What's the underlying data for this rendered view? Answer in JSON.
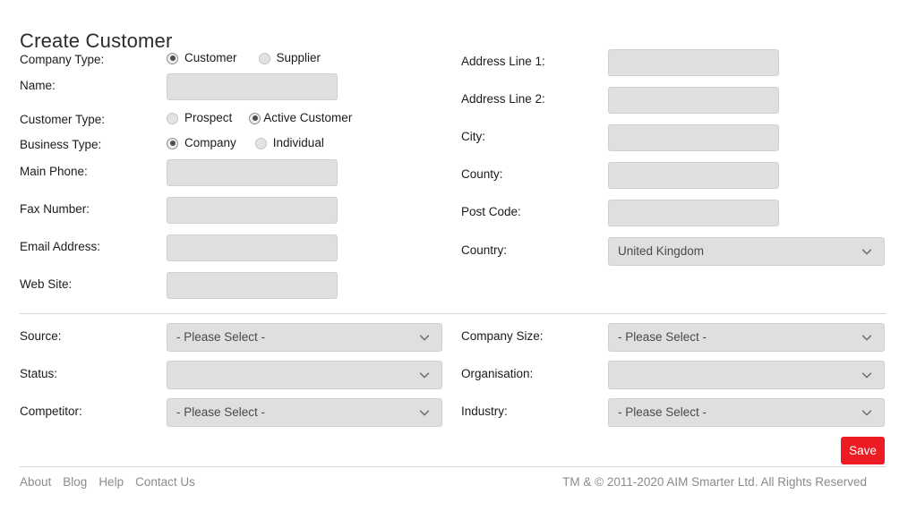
{
  "page": {
    "title": "Create Customer"
  },
  "colors": {
    "accent": "#ed1c24",
    "field_bg": "#dfdfdf",
    "field_border": "#cfcfcf",
    "label_text": "#1b1b1b",
    "footer_text": "#8b8b8b",
    "divider": "#d7d7d7"
  },
  "form": {
    "left": {
      "company_type": {
        "label": "Company Type:",
        "options": [
          {
            "label": "Customer",
            "checked": true
          },
          {
            "label": "Supplier",
            "checked": false
          }
        ]
      },
      "name": {
        "label": "Name:",
        "value": "",
        "placeholder": ""
      },
      "customer_type": {
        "label": "Customer Type:",
        "options": [
          {
            "label": "Prospect",
            "checked": false
          },
          {
            "label": "Active Customer",
            "checked": true
          }
        ]
      },
      "business_type": {
        "label": "Business Type:",
        "options": [
          {
            "label": "Company",
            "checked": true
          },
          {
            "label": "Individual",
            "checked": false
          }
        ]
      },
      "main_phone": {
        "label": "Main Phone:",
        "value": "",
        "placeholder": ""
      },
      "fax_number": {
        "label": "Fax Number:",
        "value": "",
        "placeholder": ""
      },
      "email_address": {
        "label": "Email Address:",
        "value": "",
        "placeholder": ""
      },
      "web_site": {
        "label": "Web Site:",
        "value": "",
        "placeholder": ""
      },
      "source": {
        "label": "Source:",
        "value": "- Please Select -"
      },
      "status": {
        "label": "Status:",
        "value": ""
      },
      "competitor": {
        "label": "Competitor:",
        "value": "- Please Select -"
      }
    },
    "right": {
      "address_line_1": {
        "label": "Address Line 1:",
        "value": "",
        "placeholder": ""
      },
      "address_line_2": {
        "label": "Address Line 2:",
        "value": "",
        "placeholder": ""
      },
      "city": {
        "label": "City:",
        "value": "",
        "placeholder": ""
      },
      "county": {
        "label": "County:",
        "value": "",
        "placeholder": ""
      },
      "post_code": {
        "label": "Post Code:",
        "value": "",
        "placeholder": ""
      },
      "country": {
        "label": "Country:",
        "value": "United Kingdom"
      },
      "company_size": {
        "label": "Company Size:",
        "value": "- Please Select -"
      },
      "organisation": {
        "label": "Organisation:",
        "value": ""
      },
      "industry": {
        "label": "Industry:",
        "value": "- Please Select -"
      }
    }
  },
  "actions": {
    "save_label": "Save"
  },
  "footer": {
    "links": [
      {
        "label": "About"
      },
      {
        "label": "Blog"
      },
      {
        "label": "Help"
      },
      {
        "label": "Contact Us"
      }
    ],
    "copyright": "TM & © 2011-2020 AIM Smarter Ltd. All Rights Reserved"
  },
  "icons": {
    "chevron_down": "chevron-down-icon"
  }
}
